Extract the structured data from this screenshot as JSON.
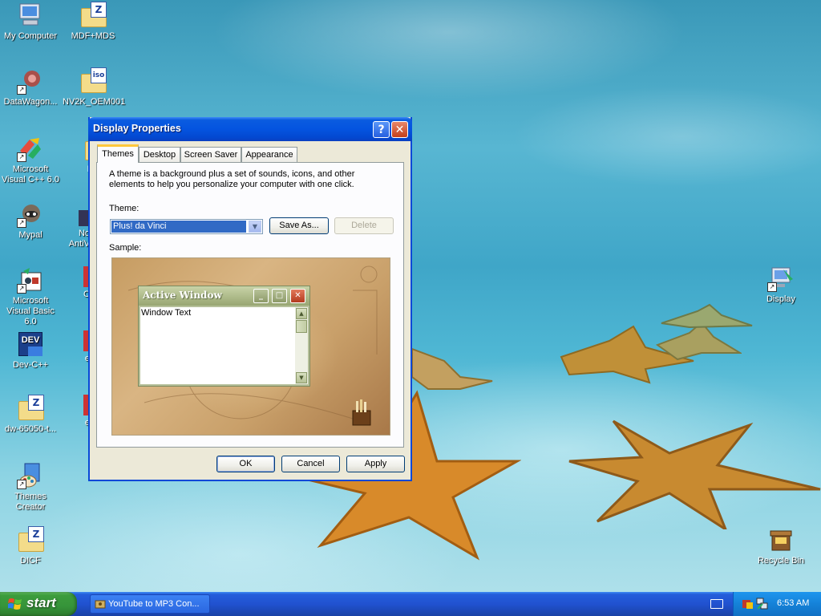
{
  "desktop": {
    "icons": [
      {
        "label": "My Computer"
      },
      {
        "label": "MDF+MDS",
        "tag": "Z"
      },
      {
        "label": "DataWagon..."
      },
      {
        "label": "NV2K_OEM001",
        "tag": "iso"
      },
      {
        "label": "Microsoft Visual C++ 6.0"
      },
      {
        "label": "F"
      },
      {
        "label": "Mypal"
      },
      {
        "label": "No AntiV"
      },
      {
        "label": "Microsoft Visual Basic 6.0"
      },
      {
        "label": "C"
      },
      {
        "label": "Dev-C++",
        "tag": "DEV"
      },
      {
        "label": "e"
      },
      {
        "label": "dw-65050-t...",
        "tag": "Z"
      },
      {
        "label": "e"
      },
      {
        "label": "Themes Creator"
      },
      {
        "label": "DICF",
        "tag": "Z"
      },
      {
        "label": "Display"
      },
      {
        "label": "Recycle Bin"
      }
    ]
  },
  "dialog": {
    "title": "Display Properties",
    "help_glyph": "?",
    "close_glyph": "✕",
    "tabs": [
      {
        "label": "Themes",
        "active": true
      },
      {
        "label": "Desktop"
      },
      {
        "label": "Screen Saver"
      },
      {
        "label": "Appearance"
      }
    ],
    "description": "A theme is a background plus a set of sounds, icons, and other elements to help you personalize your computer with one click.",
    "theme_label": "Theme:",
    "theme_value": "Plus! da Vinci",
    "save_as_label": "Save As...",
    "delete_label": "Delete",
    "sample_label": "Sample:",
    "sample": {
      "window_title": "Active Window",
      "window_text": "Window Text"
    },
    "ok_label": "OK",
    "cancel_label": "Cancel",
    "apply_label": "Apply"
  },
  "taskbar": {
    "start_label": "start",
    "task_item": "YouTube to MP3 Con...",
    "clock": "6:53 AM"
  },
  "colors": {
    "titlebar": "#0454e0",
    "dialog_bg": "#ece9d8",
    "taskbar": "#245edb",
    "start": "#3c9c3c"
  }
}
